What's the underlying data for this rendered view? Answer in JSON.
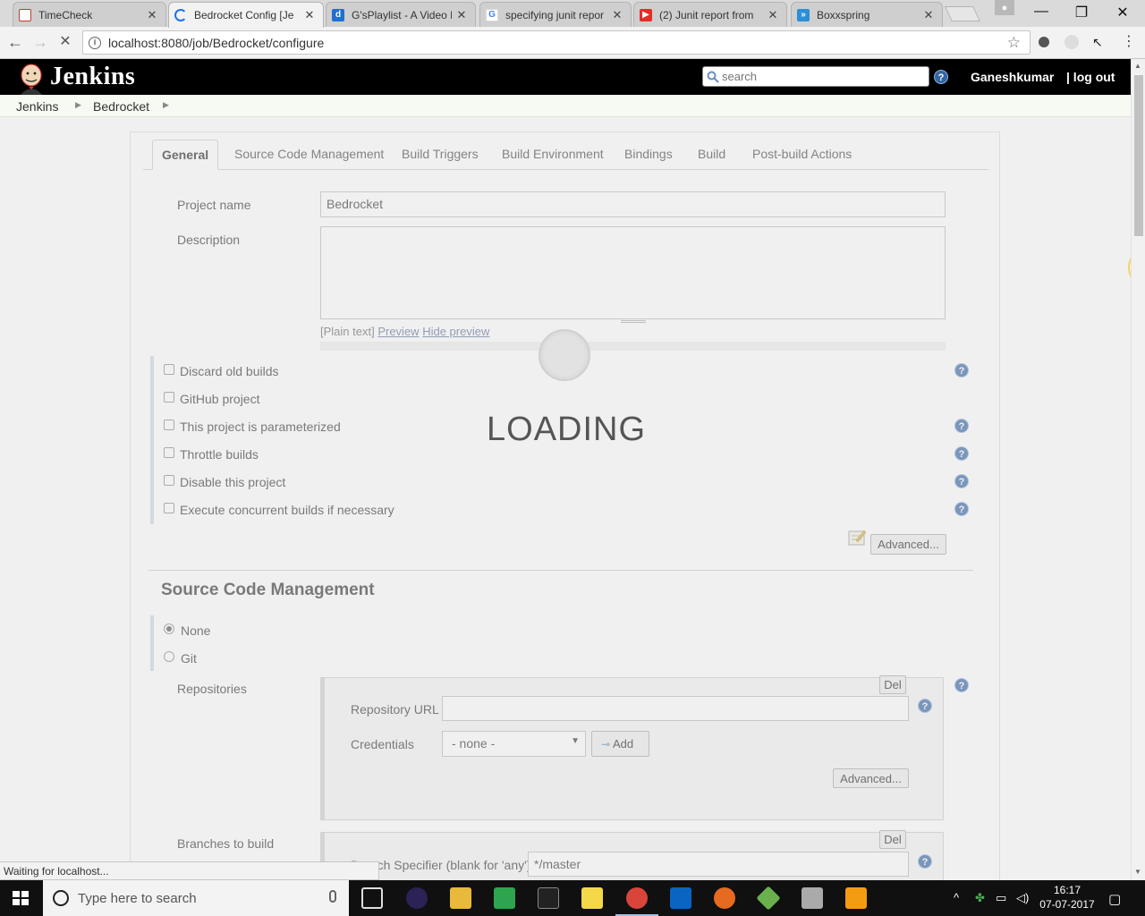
{
  "browser": {
    "tabs": [
      {
        "title": "TimeCheck",
        "favicon": "timecheck-favicon"
      },
      {
        "title": "Bedrocket Config [Je",
        "favicon": "jenkins-favicon",
        "active": true
      },
      {
        "title": "G'sPlaylist - A Video F",
        "favicon": "playlist-favicon"
      },
      {
        "title": "specifying junit repor",
        "favicon": "google-favicon"
      },
      {
        "title": "(2) Junit report from",
        "favicon": "youtube-favicon"
      },
      {
        "title": "Boxxspring",
        "favicon": "boxxspring-favicon"
      }
    ],
    "url": "localhost:8080/job/Bedrocket/configure",
    "status_text": "Waiting for localhost..."
  },
  "jenkins": {
    "logo_text": "Jenkins",
    "search_placeholder": "search",
    "user": "Ganeshkumar",
    "logout": "| log out",
    "breadcrumb": [
      "Jenkins",
      "Bedrocket"
    ]
  },
  "config": {
    "tabs": [
      "General",
      "Source Code Management",
      "Build Triggers",
      "Build Environment",
      "Bindings",
      "Build",
      "Post-build Actions"
    ],
    "active_tab": "General",
    "project_name_label": "Project name",
    "project_name_value": "Bedrocket",
    "description_label": "Description",
    "description_value": "",
    "format_plain": "[Plain text]",
    "preview_link": "Preview",
    "hide_preview_link": "Hide preview",
    "options": [
      {
        "label": "Discard old builds",
        "checked": false,
        "help": true
      },
      {
        "label": "GitHub project",
        "checked": false,
        "help": false
      },
      {
        "label": "This project is parameterized",
        "checked": false,
        "help": true
      },
      {
        "label": "Throttle builds",
        "checked": false,
        "help": true
      },
      {
        "label": "Disable this project",
        "checked": false,
        "help": true
      },
      {
        "label": "Execute concurrent builds if necessary",
        "checked": false,
        "help": true
      }
    ],
    "advanced_label": "Advanced...",
    "scm": {
      "title": "Source Code Management",
      "none_label": "None",
      "git_label": "Git",
      "selected": "None",
      "repositories_label": "Repositories",
      "del_label": "Del",
      "repo_url_label": "Repository URL",
      "repo_url_value": "",
      "credentials_label": "Credentials",
      "credentials_value": "- none -",
      "add_label": "Add",
      "advanced_label": "Advanced...",
      "branches_label": "Branches to build",
      "branch_specifier_label": "Branch Specifier (blank for 'any')",
      "branch_specifier_value": "*/master"
    }
  },
  "overlay": {
    "loading_text": "LOADING"
  },
  "taskbar": {
    "search_placeholder": "Type here to search",
    "time": "16:17",
    "date": "07-07-2017"
  },
  "colors": {
    "jenkins_header": "#000000",
    "help_icon": "#3465a4",
    "overlay": "#dcdcdc"
  }
}
